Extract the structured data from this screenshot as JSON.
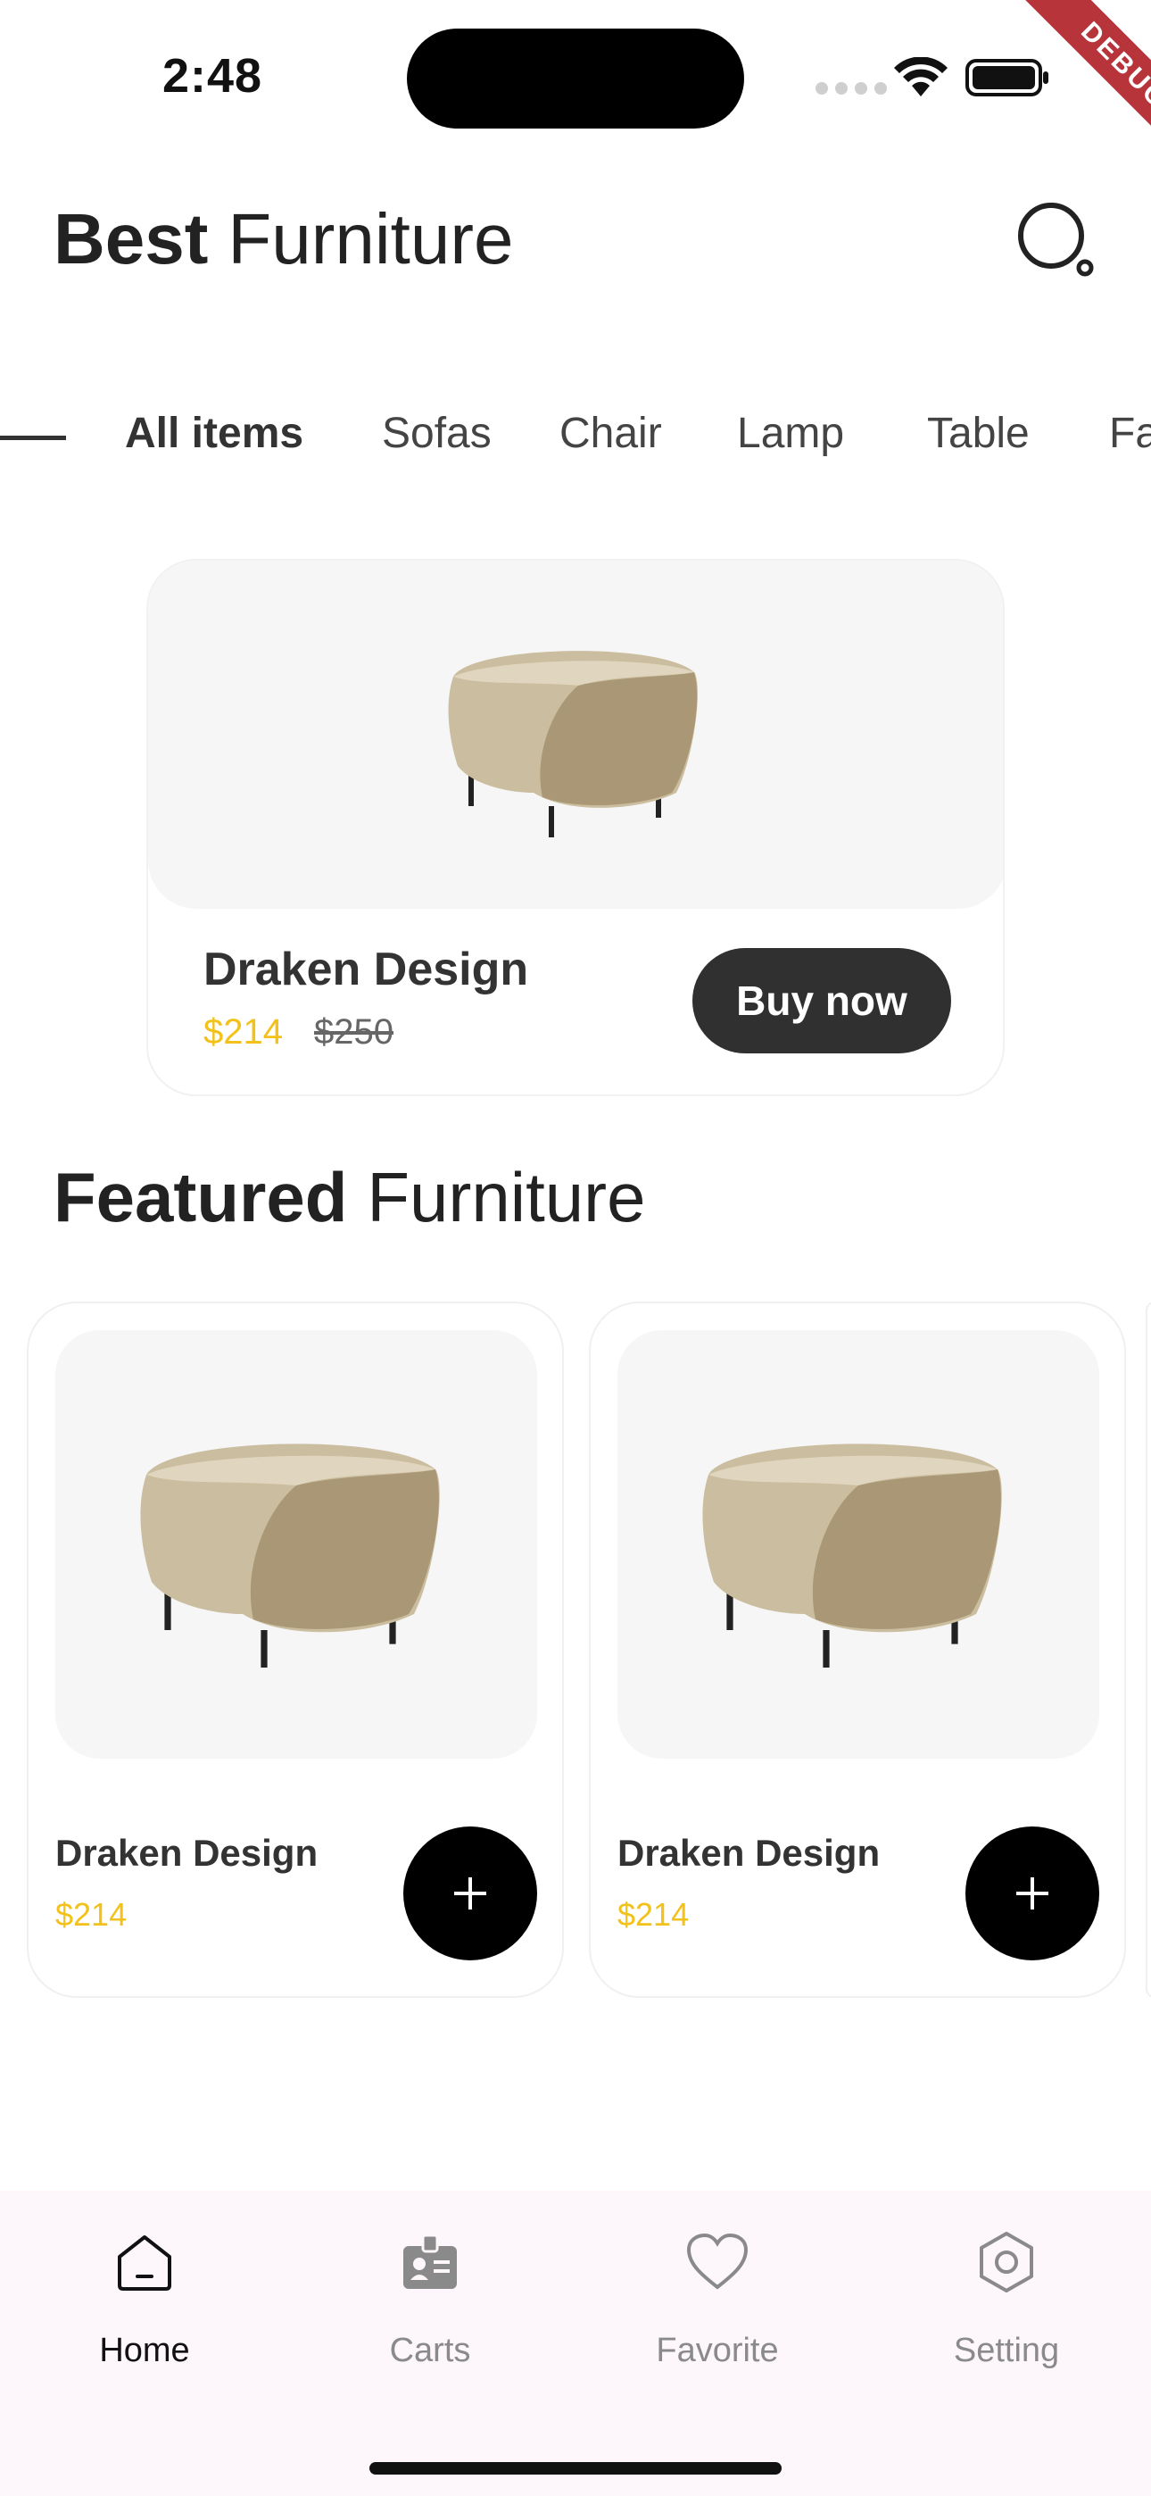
{
  "status_bar": {
    "time": "2:48",
    "debug_label": "DEBUG"
  },
  "header": {
    "title_bold": "Best",
    "title_light": "Furniture",
    "search_icon": "search-icon"
  },
  "tabs": [
    {
      "label": "All items",
      "active": true
    },
    {
      "label": "Sofas",
      "active": false
    },
    {
      "label": "Chair",
      "active": false
    },
    {
      "label": "Lamp",
      "active": false
    },
    {
      "label": "Table",
      "active": false
    },
    {
      "label": "Fa",
      "active": false
    }
  ],
  "promo": {
    "name": "Draken Design",
    "price": "$214",
    "old_price": "$250",
    "button_label": "Buy now"
  },
  "featured": {
    "title_bold": "Featured",
    "title_light": "Furniture",
    "items": [
      {
        "name": "Draken Design",
        "price": "$214"
      },
      {
        "name": "Draken Design",
        "price": "$214"
      }
    ]
  },
  "bottom_nav": [
    {
      "label": "Home",
      "icon": "home-icon",
      "active": true
    },
    {
      "label": "Carts",
      "icon": "cart-badge-icon",
      "active": false
    },
    {
      "label": "Favorite",
      "icon": "heart-icon",
      "active": false
    },
    {
      "label": "Setting",
      "icon": "gear-icon",
      "active": false
    }
  ],
  "colors": {
    "accent_price": "#f2c11a",
    "button_dark": "#303030",
    "nav_background": "#fdf6fb",
    "debug_banner": "#b8343b"
  }
}
